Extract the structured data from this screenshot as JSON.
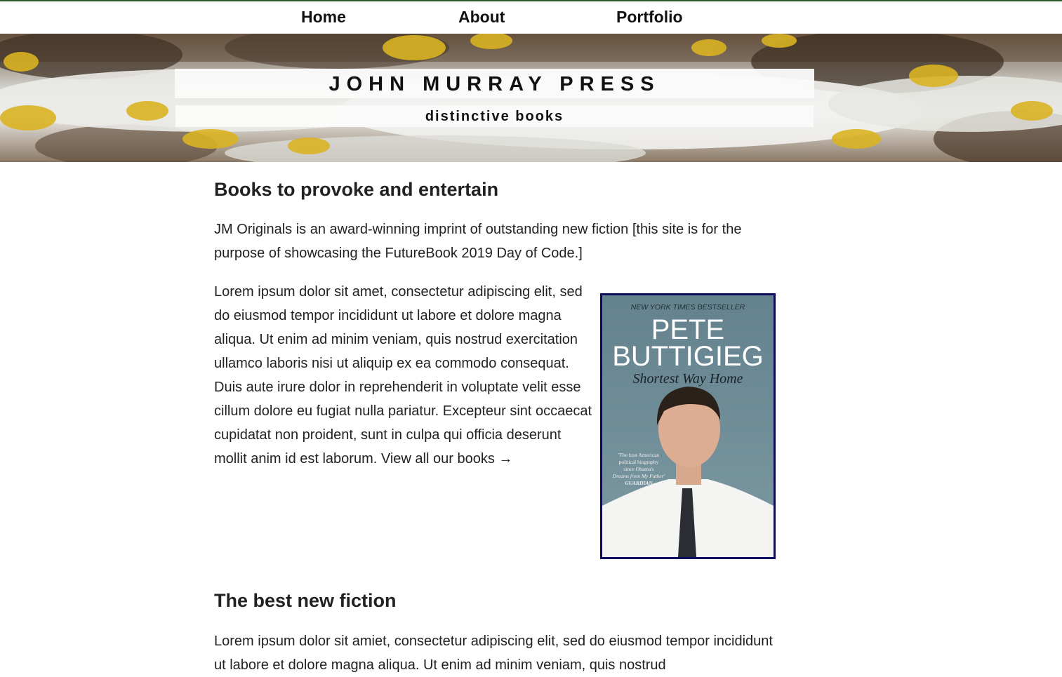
{
  "nav": {
    "home": "Home",
    "about": "About",
    "portfolio": "Portfolio"
  },
  "hero": {
    "title": "JOHN MURRAY PRESS",
    "subtitle": "distinctive books"
  },
  "section1": {
    "heading": "Books to provoke and entertain",
    "intro": "JM Originals is an award-winning imprint of outstanding new fiction [this site is for the purpose of showcasing the FutureBook 2019 Day of Code.]",
    "body": "Lorem ipsum dolor sit amet, consectetur adipiscing elit, sed do eiusmod tempor incididunt ut labore et dolore magna aliqua. Ut enim ad minim veniam, quis nostrud exercitation ullamco laboris nisi ut aliquip ex ea commodo consequat. Duis aute irure dolor in reprehenderit in voluptate velit esse cillum dolore eu fugiat nulla pariatur. Excepteur sint occaecat cupidatat non proident, sunt in culpa qui officia deserunt mollit anim id est laborum. ",
    "link": "View all our books →"
  },
  "book": {
    "bestseller": "NEW YORK TIMES BESTSELLER",
    "author_line1": "PETE",
    "author_line2": "BUTTIGIEG",
    "title": "Shortest Way Home",
    "quote_1": "'The best American",
    "quote_2": "political biography",
    "quote_3": "since Obama's",
    "quote_4": "Dreams from My Father'",
    "quote_source": "GUARDIAN"
  },
  "section2": {
    "heading": "The best new fiction",
    "body": "Lorem ipsum dolor sit amiet, consectetur adipiscing elit, sed do eiusmod tempor incididunt ut labore et dolore magna aliqua. Ut enim ad minim veniam, quis nostrud"
  },
  "colors": {
    "cover_border": "#0c0c5c",
    "cover_bg": "#6f8f9a",
    "accent_line": "#2c5a2c"
  }
}
